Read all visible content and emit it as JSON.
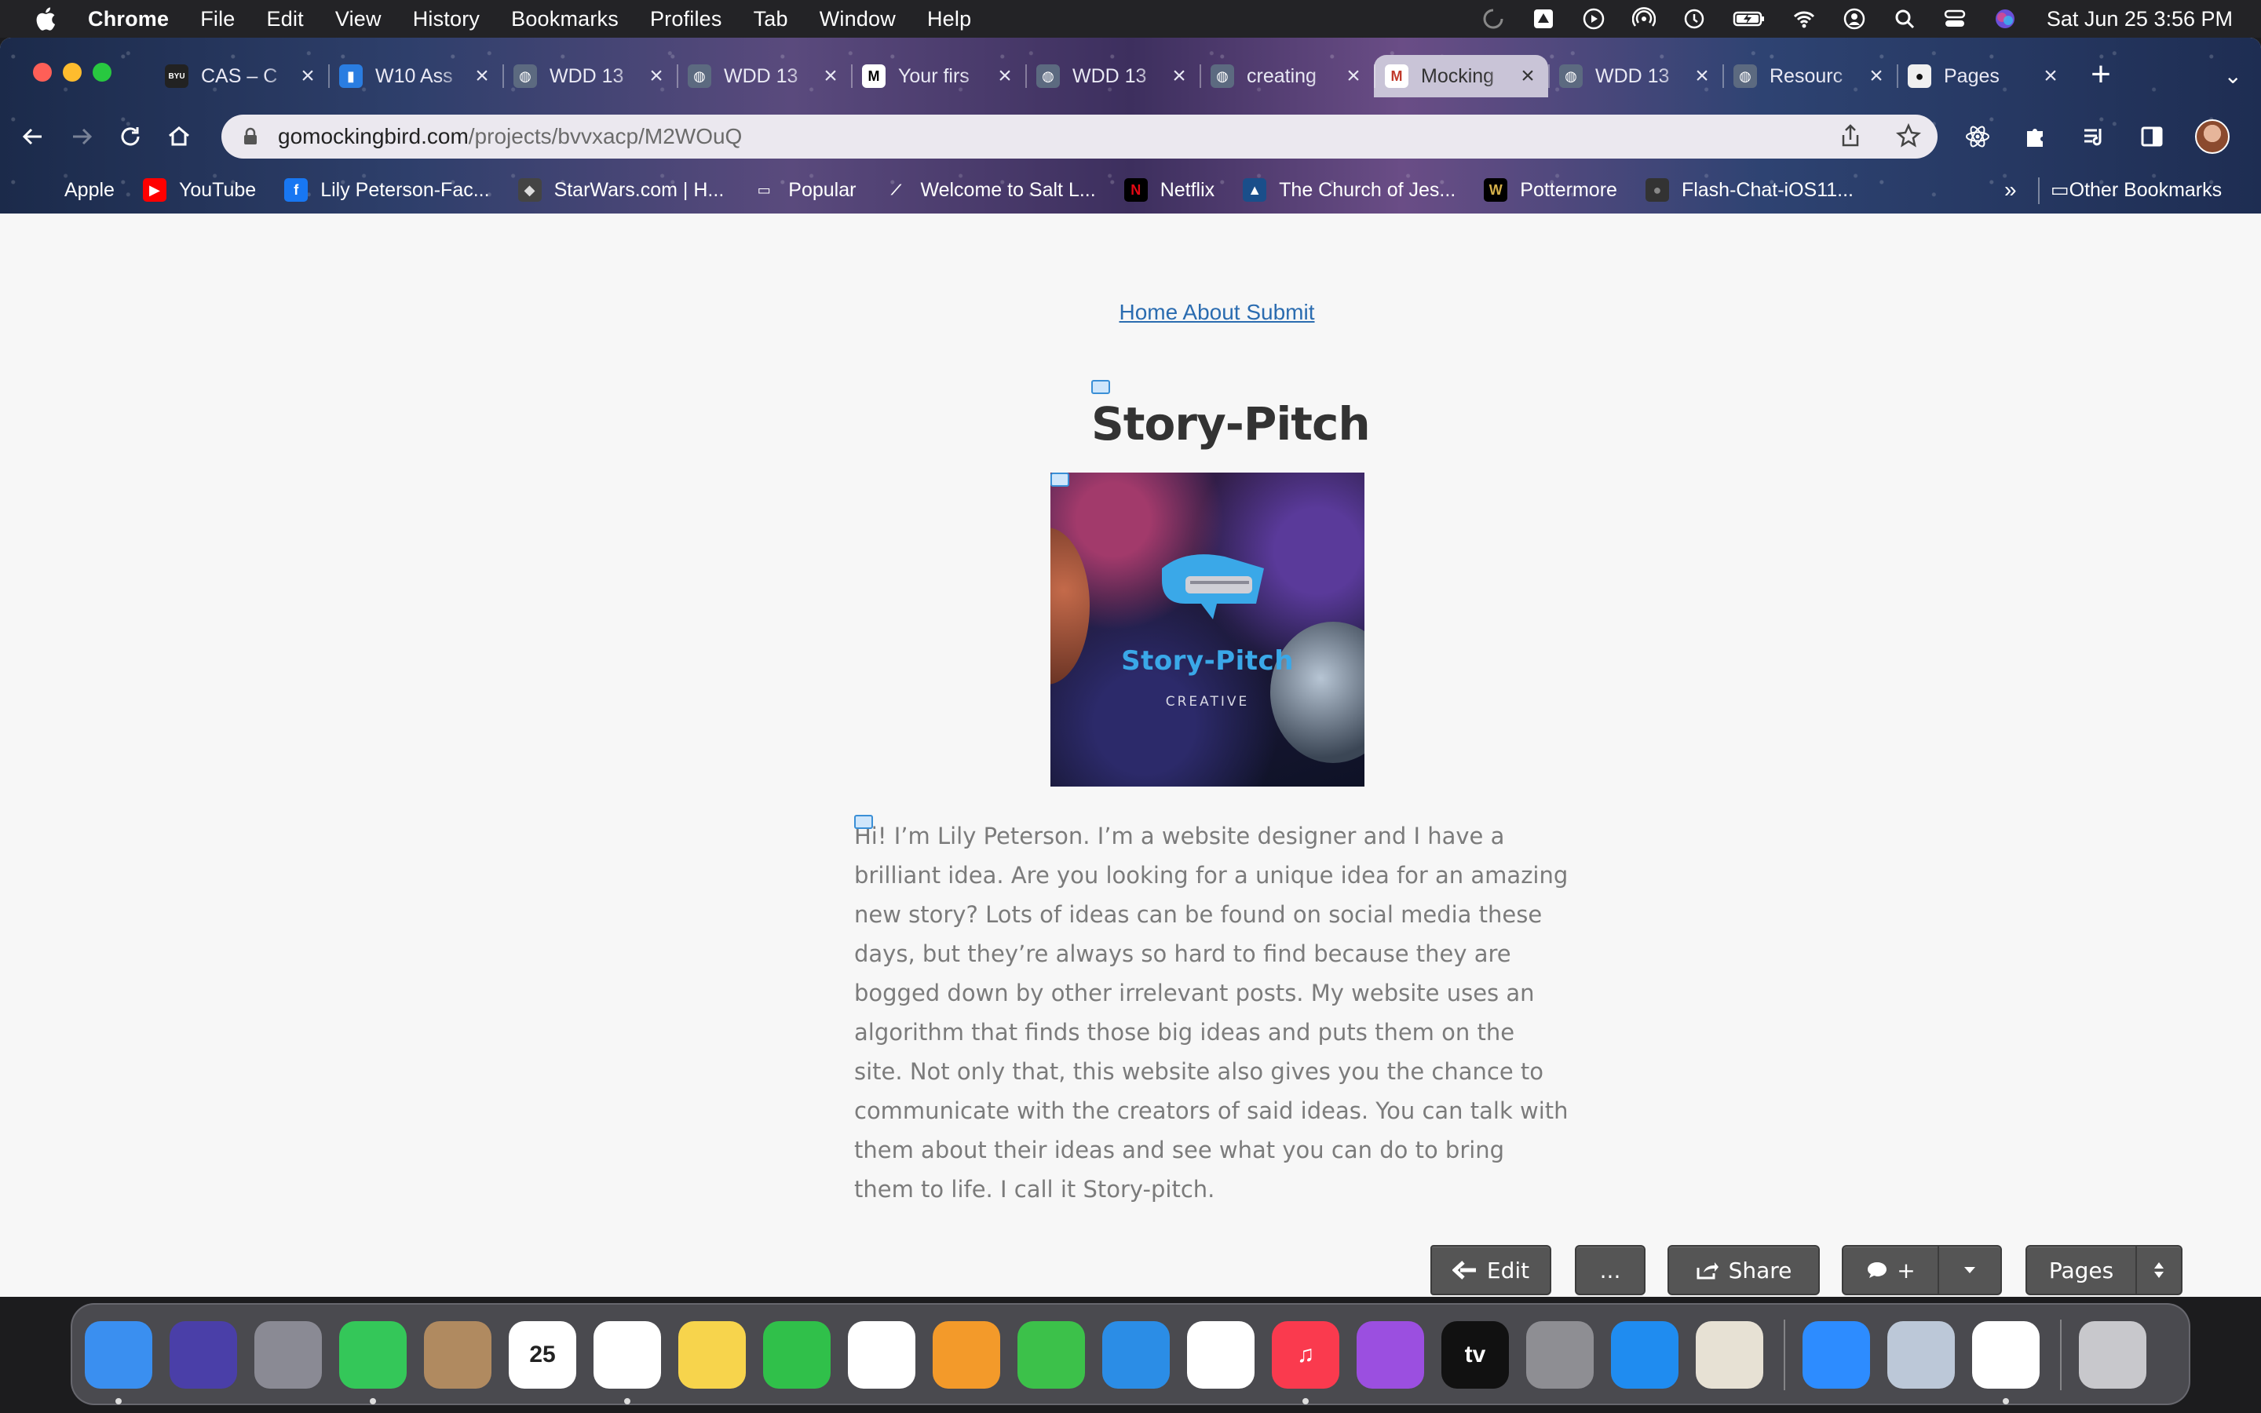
{
  "menubar": {
    "app_name": "Chrome",
    "items": [
      "File",
      "Edit",
      "View",
      "History",
      "Bookmarks",
      "Profiles",
      "Tab",
      "Window",
      "Help"
    ],
    "clock": "Sat Jun 25  3:56 PM"
  },
  "browser": {
    "tabs": [
      {
        "label": "CAS – C",
        "favicon": "byu-icon",
        "active": false
      },
      {
        "label": "W10 Ass",
        "favicon": "bars-chart-icon",
        "active": false
      },
      {
        "label": "WDD 13",
        "favicon": "globe-icon",
        "active": false
      },
      {
        "label": "WDD 13",
        "favicon": "globe-icon",
        "active": false
      },
      {
        "label": "Your firs",
        "favicon": "medium-icon",
        "active": false
      },
      {
        "label": "WDD 13",
        "favicon": "globe-icon",
        "active": false
      },
      {
        "label": "creating",
        "favicon": "globe-icon",
        "active": false
      },
      {
        "label": "Mocking",
        "favicon": "mockingbird-icon",
        "active": true
      },
      {
        "label": "WDD 13",
        "favicon": "globe-icon",
        "active": false
      },
      {
        "label": "Resourc",
        "favicon": "globe-icon",
        "active": false
      },
      {
        "label": "Pages",
        "favicon": "github-icon",
        "active": false
      }
    ],
    "url_host": "gomockingbird.com",
    "url_path": "/projects/bvvxacp/M2WOuQ",
    "bookmarks": [
      {
        "label": "Apple",
        "icon": "apple-icon"
      },
      {
        "label": "YouTube",
        "icon": "youtube-icon"
      },
      {
        "label": "Lily Peterson-Fac...",
        "icon": "facebook-icon"
      },
      {
        "label": "StarWars.com | H...",
        "icon": "starwars-icon"
      },
      {
        "label": "Popular",
        "icon": "folder-icon"
      },
      {
        "label": "Welcome to Salt L...",
        "icon": "saltlake-icon"
      },
      {
        "label": "Netflix",
        "icon": "netflix-icon"
      },
      {
        "label": "The Church of Jes...",
        "icon": "church-icon"
      },
      {
        "label": "Pottermore",
        "icon": "pottermore-icon"
      },
      {
        "label": "Flash-Chat-iOS11...",
        "icon": "github-icon"
      }
    ],
    "bookmarks_more": "»",
    "other_bookmarks": "Other Bookmarks"
  },
  "page": {
    "nav_links": "Home About Submit",
    "title": "Story-Pitch",
    "hero_title": "Story-Pitch",
    "hero_subtitle": "CREATIVE",
    "body": "Hi! I’m Lily Peterson. I’m a website designer and I have a brilliant idea. Are you looking for a unique idea for an amazing new story? Lots of ideas can be found on social media these days, but they’re always so hard to find because they are bogged down by other irrelevant posts. My website uses an algorithm that finds those big ideas and puts them on the site. Not only that, this website also gives you the chance to communicate with the creators of said ideas. You can talk with them about their ideas and see what you can do to bring them to life. I call it Story-pitch."
  },
  "mockingbird_toolbar": {
    "edit_label": "Edit",
    "more_label": "...",
    "share_label": "Share",
    "comment_label": "+",
    "pages_label": "Pages"
  },
  "dock": {
    "apps": [
      {
        "name": "finder",
        "color": "#3a8ff0",
        "glyph": "",
        "running": true
      },
      {
        "name": "siri",
        "color": "#4a3fa8",
        "glyph": "",
        "running": false
      },
      {
        "name": "launchpad",
        "color": "#8a8a94",
        "glyph": "",
        "running": false
      },
      {
        "name": "messages",
        "color": "#34c759",
        "glyph": "",
        "running": true
      },
      {
        "name": "contacts",
        "color": "#b08a60",
        "glyph": "",
        "running": false
      },
      {
        "name": "calendar",
        "color": "#ffffff",
        "glyph": "25",
        "running": false
      },
      {
        "name": "chrome",
        "color": "#ffffff",
        "glyph": "",
        "running": true
      },
      {
        "name": "notes",
        "color": "#f7d44c",
        "glyph": "",
        "running": false
      },
      {
        "name": "facetime",
        "color": "#30c04a",
        "glyph": "",
        "running": false
      },
      {
        "name": "photos",
        "color": "#ffffff",
        "glyph": "",
        "running": false
      },
      {
        "name": "pages",
        "color": "#f39a2a",
        "glyph": "",
        "running": false
      },
      {
        "name": "numbers",
        "color": "#3cc14a",
        "glyph": "",
        "running": false
      },
      {
        "name": "keynote",
        "color": "#2b8de6",
        "glyph": "",
        "running": false
      },
      {
        "name": "news",
        "color": "#ffffff",
        "glyph": "",
        "running": false
      },
      {
        "name": "music",
        "color": "#fa3a4e",
        "glyph": "♫",
        "running": true
      },
      {
        "name": "podcasts",
        "color": "#9b4fe0",
        "glyph": "",
        "running": false
      },
      {
        "name": "apple-tv",
        "color": "#111111",
        "glyph": "tv",
        "running": false
      },
      {
        "name": "system-preferences",
        "color": "#8e8e93",
        "glyph": "",
        "running": false
      },
      {
        "name": "app-store",
        "color": "#1f8cf0",
        "glyph": "",
        "running": false
      },
      {
        "name": "python-idle",
        "color": "#e7e1d4",
        "glyph": "",
        "running": false
      },
      {
        "name": "zoom",
        "color": "#2d8cff",
        "glyph": "",
        "running": false
      },
      {
        "name": "preview",
        "color": "#bcc8d8",
        "glyph": "",
        "running": false
      },
      {
        "name": "vscode",
        "color": "#ffffff",
        "glyph": "",
        "running": true
      },
      {
        "name": "trash",
        "color": "#c8c8cc",
        "glyph": "",
        "running": false
      }
    ]
  }
}
